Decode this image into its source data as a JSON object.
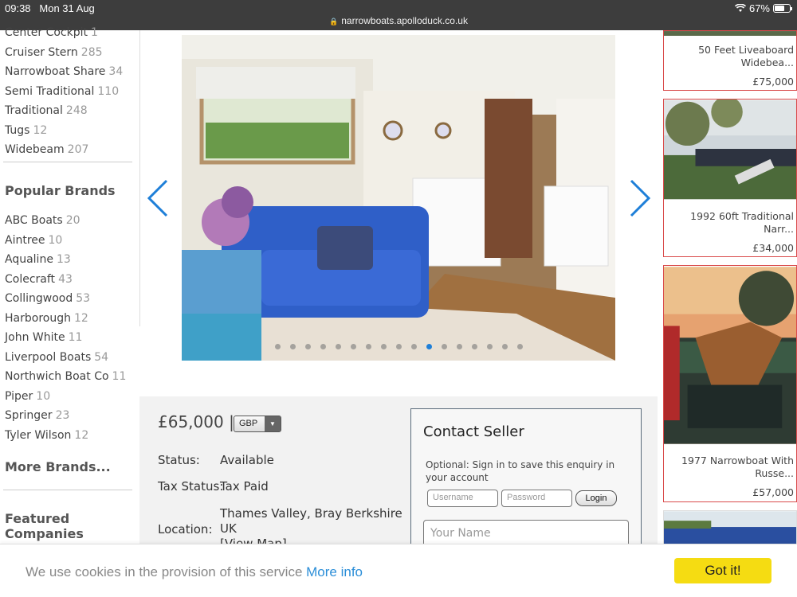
{
  "status_bar": {
    "time": "09:38",
    "date": "Mon 31 Aug",
    "battery": "67%",
    "url": "narrowboats.apolloduck.co.uk"
  },
  "sidebar": {
    "types": [
      {
        "label": "Center Cockpit",
        "count": "1"
      },
      {
        "label": "Cruiser Stern",
        "count": "285"
      },
      {
        "label": "Narrowboat Share",
        "count": "34"
      },
      {
        "label": "Semi Traditional",
        "count": "110"
      },
      {
        "label": "Traditional",
        "count": "248"
      },
      {
        "label": "Tugs",
        "count": "12"
      },
      {
        "label": "Widebeam",
        "count": "207"
      }
    ],
    "brands_heading": "Popular Brands",
    "brands": [
      {
        "label": "ABC Boats",
        "count": "20"
      },
      {
        "label": "Aintree",
        "count": "10"
      },
      {
        "label": "Aqualine",
        "count": "13"
      },
      {
        "label": "Colecraft",
        "count": "43"
      },
      {
        "label": "Collingwood",
        "count": "53"
      },
      {
        "label": "Harborough",
        "count": "12"
      },
      {
        "label": "John White",
        "count": "11"
      },
      {
        "label": "Liverpool Boats",
        "count": "54"
      },
      {
        "label": "Northwich Boat Co",
        "count": "11"
      },
      {
        "label": "Piper",
        "count": "10"
      },
      {
        "label": "Springer",
        "count": "23"
      },
      {
        "label": "Tyler Wilson",
        "count": "12"
      }
    ],
    "more_brands": "More Brands...",
    "featured_heading": "Featured Companies"
  },
  "listing": {
    "price": "£65,000",
    "separator": "|",
    "currency": "GBP",
    "status_label": "Status:",
    "status_value": "Available",
    "tax_label": "Tax Status:",
    "tax_value": "Tax Paid",
    "location_label": "Location:",
    "location_line1": "Thames Valley, Bray Berkshire",
    "location_line2": "UK",
    "view_map": "[View Map]",
    "photo_count": 17,
    "active_photo": 10
  },
  "contact": {
    "title": "Contact Seller",
    "note": "Optional: Sign in to save this enquiry in your account",
    "username_placeholder": "Username",
    "password_placeholder": "Password",
    "login_label": "Login",
    "name_placeholder": "Your Name"
  },
  "related": [
    {
      "title_line1": "50 Feet Liveaboard",
      "title_line2": "Widebea...",
      "price": "£75,000"
    },
    {
      "title_line1": "1992 60ft Traditional",
      "title_line2": "Narr...",
      "price": "£34,000"
    },
    {
      "title_line1": "1977 Narrowboat With",
      "title_line2": "Russe...",
      "price": "£57,000"
    }
  ],
  "cookie": {
    "text": "We use cookies in the provision of this service",
    "more_info": "More info",
    "button": "Got it!"
  },
  "colors": {
    "accent": "#1e7fd8",
    "card_border": "#d94b4b",
    "cookie_button": "#f5dc12"
  }
}
